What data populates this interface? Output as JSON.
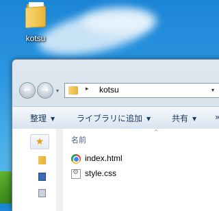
{
  "desktop": {
    "icon_label": "kotsu"
  },
  "window": {
    "address": {
      "separator": "▸",
      "path": "kotsu",
      "dropdown": "▾",
      "refresh": "⟳"
    },
    "nav": {
      "back": "←",
      "forward": "→",
      "history_dropdown": "▾"
    },
    "toolbar": {
      "organize": "整理",
      "include_in_library": "ライブラリに追加",
      "share": "共有",
      "more": "»",
      "dropdown_arrow": "▼"
    },
    "navpane": {
      "favorites_glyph": "★"
    },
    "list": {
      "column_name": "名前",
      "sort_caret": "^",
      "files": [
        {
          "name": "index.html",
          "icon": "chrome-html-icon"
        },
        {
          "name": "style.css",
          "icon": "css-file-icon"
        }
      ]
    }
  }
}
